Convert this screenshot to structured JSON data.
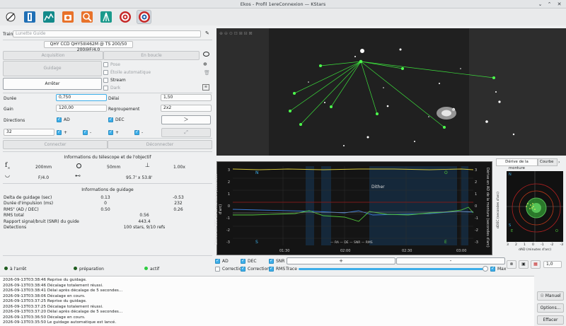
{
  "window": {
    "title": "Ekos - Profil 1ereConnexion — KStars"
  },
  "toolbar": {
    "icons": [
      "setup-icon",
      "ccd-icon",
      "focus-icon",
      "mount-icon",
      "align-icon",
      "guide-icon",
      "observatory-icon",
      "target-icon"
    ]
  },
  "train": {
    "label": "Train",
    "value": "Lunette Guide"
  },
  "camera": {
    "name": "QHY CCD QHY5III462M @ TS 200/50 200@F/4.0"
  },
  "buttons": {
    "acquisition": "Acquisition",
    "loop": "En boucle",
    "guidage": "Guidage",
    "arreter": "Arrêter",
    "connecter": "Connecter",
    "deconnecter": "Déconnecter"
  },
  "options": {
    "pose": "Pose",
    "etoile_auto": "Étoile automatique",
    "stream": "Stream",
    "dark": "Dark"
  },
  "settings": {
    "duree_label": "Durée",
    "duree_value": "0,750",
    "delai_label": "Délai",
    "delai_value": "1,50",
    "gain_label": "Gain",
    "gain_value": "120,00",
    "regroupement_label": "Regroupement",
    "regroupement_value": "2x2",
    "directions_label": "Directions",
    "ad_label": "AD",
    "dec_label": "DEC",
    "size_value": "32",
    "plus": "+",
    "minus": "-"
  },
  "telescope": {
    "title": "Informations du télescope et de l'objectif",
    "focal": "200mm",
    "aperture": "50mm",
    "scale": "1.00x",
    "fratio": "F/4.0",
    "fov": "95.7' x 53.8'"
  },
  "guideinfo": {
    "title": "Informations de guidage",
    "rows": [
      {
        "label": "Delta de guidage (sec)",
        "a": "0.13",
        "b": "-0.53"
      },
      {
        "label": "Durée d'impulsion (ms)",
        "a": "0",
        "b": "232"
      },
      {
        "label": "RMS\" (AD / DEC)",
        "a": "0.50",
        "b": "0.26"
      },
      {
        "label": "RMS total",
        "a": "0.56",
        "b": ""
      },
      {
        "label": "Rapport signal/bruit (SNR) du guide",
        "a": "443.4",
        "b": ""
      },
      {
        "label": "Detections",
        "a": "100 stars, 9/10 refs",
        "b": ""
      }
    ]
  },
  "status": {
    "stopped": "à l'arrêt",
    "prep": "préparation",
    "active": "actif",
    "colors": {
      "stopped": "#1e5c1e",
      "prep": "#1e5c1e",
      "active": "#2ecc40"
    }
  },
  "graph": {
    "left_axis": "Dérive en DEC de la monture (secondes d'arc)",
    "right_axis": "Dérive en AD de la monture (secondes d'arc)",
    "N": "N",
    "S": "S",
    "O": "O",
    "E": "E",
    "dither": "Dither",
    "xticks": [
      "01:30",
      "02:00",
      "02:30",
      "03:00"
    ],
    "yticks": [
      "3",
      "2",
      "1",
      "0",
      "-1",
      "-2",
      "-3"
    ],
    "legend": [
      "RA",
      "DE",
      "SNR",
      "RMS"
    ]
  },
  "graphcontrols": {
    "ad": "AD",
    "dec": "DEC",
    "snr": "SNR",
    "plus": "+",
    "minus": "-",
    "correction1": "Correction",
    "correction2": "Correction",
    "rms": "RMS",
    "trace": "Trace",
    "max": "Max",
    "zoom": "1,0"
  },
  "scatter": {
    "tab1": "Dérive de la monture",
    "tab2": "Courbe",
    "xlabel": "dAD (minutes d'arc)",
    "ylabel": "dDEC (secondes d'arc)",
    "N": "N",
    "S": "S",
    "E": "E",
    "O": "O",
    "ticks": [
      "3",
      "2",
      "1",
      "0",
      "-1",
      "-2",
      "-3"
    ]
  },
  "log": {
    "lines": [
      "2026-09-13T03:38:46 Reprise du guidage.",
      "2026-09-13T03:38:46 Décalage totalement réussi.",
      "2026-09-13T03:38:41 Délai après décalage de 5 secondes...",
      "2026-09-13T03:38:06 Décalage en cours.",
      "2026-09-13T03:37:25 Reprise du guidage.",
      "2026-09-13T03:37:25 Décalage totalement réussi.",
      "2026-09-13T03:37:20 Délai après décalage de 5 secondes...",
      "2026-09-13T03:36:50 Décalage en cours.",
      "2026-09-13T03:35:50 Le guidage automatique est lancé."
    ],
    "manuel": "Manuel",
    "options": "Options...",
    "effacer": "Effacer"
  }
}
